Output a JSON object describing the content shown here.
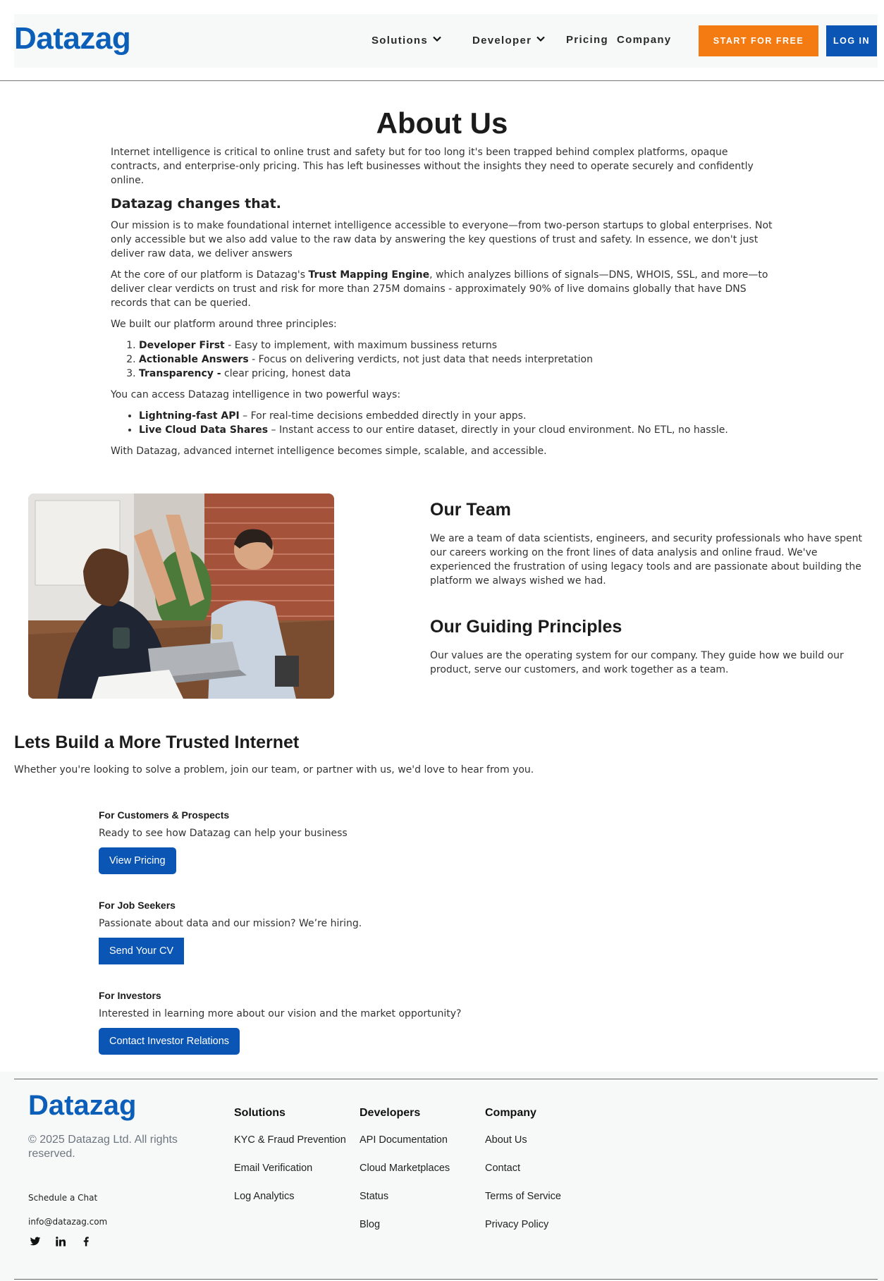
{
  "header": {
    "logo": "Datazag",
    "nav": {
      "solutions": "Solutions",
      "developer": "Developer",
      "pricing": "Pricing",
      "company": "Company"
    },
    "start_label": "START FOR FREE",
    "login_label": "LOG IN",
    "colors": {
      "brand": "#0b5fb8",
      "start": "#f47a12",
      "login": "#0b55b4"
    }
  },
  "about": {
    "title": "About Us",
    "intro": "Internet intelligence is critical to online trust and safety but for too long it's been trapped behind complex platforms, opaque contracts, and enterprise-only pricing. This has left  businesses without the insights they need to operate securely and confidently online.",
    "subhead": "Datazag changes that.",
    "mission": "Our mission is to make foundational internet intelligence accessible to everyone—from two-person startups to global enterprises. Not only accessible but we also add value to the raw data by answering the key questions of trust and safety. In essence, we don't just deliver raw data, we deliver answers",
    "core_pre": "At the core of our platform is Datazag's ",
    "core_bold": "Trust Mapping Engine",
    "core_post": ", which analyzes billions of signals—DNS, WHOIS, SSL, and more—to deliver clear verdicts on  trust and risk for more than 275M domains - approximately 90% of live domains globally that have DNS records that can be queried.",
    "principles_intro": "We built our platform around three principles:",
    "principles": [
      {
        "bold": "Developer First",
        "text": " - Easy to implement, with maximum bussiness returns"
      },
      {
        "bold": "Actionable Answers",
        "text": " - Focus on delivering verdicts, not just data that needs interpretation"
      },
      {
        "bold": "Transparency -",
        "text": " clear pricing, honest data"
      }
    ],
    "access_intro": "You can access Datazag intelligence in two powerful ways:",
    "access": [
      {
        "bold": "Lightning-fast API",
        "text": " – For real-time decisions embedded directly in your apps."
      },
      {
        "bold": "Live Cloud Data Shares",
        "text": " – Instant access to our entire dataset, directly in your cloud environment. No ETL, no hassle."
      }
    ],
    "closing": "With Datazag, advanced internet intelligence becomes simple, scalable, and accessible."
  },
  "team": {
    "title": "Our Team",
    "body": "We are a team of data scientists, engineers, and security professionals who have spent our careers working on the front lines of data analysis and online fraud. We've experienced the frustration of using legacy tools and are passionate about building the platform we always wished we had.",
    "principles_title": "Our Guiding Principles",
    "principles_body": "Our values are the operating system for our company. They guide how we build our product, serve our customers, and work together as a team."
  },
  "build": {
    "title": "Lets Build a More Trusted Internet",
    "lead": "Whether you're looking to solve a problem, join our team, or partner with us, we'd love to hear from you.",
    "blocks": [
      {
        "title": "For Customers & Prospects",
        "text": "Ready to see how Datazag can help your business",
        "button": "View Pricing"
      },
      {
        "title": "For Job Seekers",
        "text": "Passionate about data and our mission? We’re hiring.",
        "button": "Send Your CV"
      },
      {
        "title": "For Investors",
        "text": "Interested in learning more about our vision and the market opportunity?",
        "button": "Contact Investor Relations"
      }
    ]
  },
  "footer": {
    "logo": "Datazag",
    "copyright": "© 2025 Datazag Ltd. All rights reserved.",
    "schedule": "Schedule a Chat",
    "email": "info@datazag.com",
    "social_icons": [
      "twitter-icon",
      "linkedin-icon",
      "facebook-icon"
    ],
    "columns": [
      {
        "title": "Solutions",
        "links": [
          "KYC & Fraud Prevention",
          "Email Verification",
          "Log Analytics"
        ]
      },
      {
        "title": "Developers",
        "links": [
          "API Documentation",
          "Cloud Marketplaces",
          "Status",
          "Blog"
        ]
      },
      {
        "title": "Company",
        "links": [
          "About  Us",
          "Contact",
          "Terms of Service",
          "Privacy Policy"
        ]
      }
    ]
  }
}
